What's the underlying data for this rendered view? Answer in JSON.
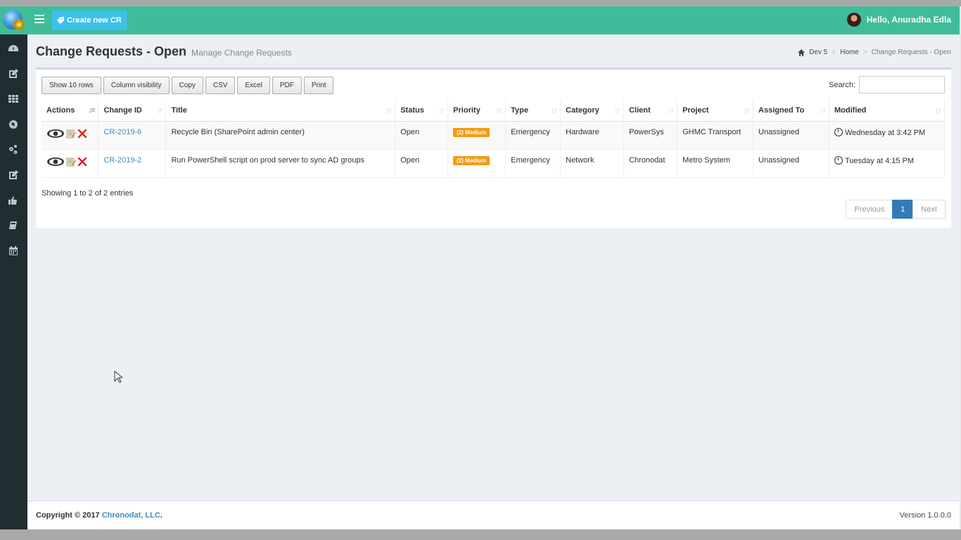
{
  "topbar": {
    "create_label": "Create new CR",
    "greeting": "Hello, Anuradha Edla"
  },
  "sidebar": {
    "icons": [
      "dashboard-icon",
      "edit-icon",
      "grid-icon",
      "globe-icon",
      "cogs-icon",
      "edit-icon",
      "thumbs-up-icon",
      "book-icon",
      "calendar-icon"
    ]
  },
  "page": {
    "title": "Change Requests - Open",
    "subtitle": "Manage Change Requests"
  },
  "breadcrumb": {
    "items": [
      "Dev 5",
      "Home",
      "Change Requests - Open"
    ]
  },
  "toolbar": {
    "buttons": [
      "Show 10 rows",
      "Column visibility",
      "Copy",
      "CSV",
      "Excel",
      "PDF",
      "Print"
    ],
    "search_label": "Search:",
    "search_value": ""
  },
  "table": {
    "columns": [
      "Actions",
      "Change ID",
      "Title",
      "Status",
      "Priority",
      "Type",
      "Category",
      "Client",
      "Project",
      "Assigned To",
      "Modified"
    ],
    "rows": [
      {
        "id": "CR-2019-6",
        "title": "Recycle Bin (SharePoint admin center)",
        "status": "Open",
        "priority": "(2) Medium",
        "type": "Emergency",
        "category": "Hardware",
        "client": "PowerSys",
        "project": "GHMC Transport",
        "assigned": "Unassigned",
        "modified": "Wednesday at 3:42 PM"
      },
      {
        "id": "CR-2019-2",
        "title": "Run PowerShell script on prod server to sync AD groups",
        "status": "Open",
        "priority": "(2) Medium",
        "type": "Emergency",
        "category": "Network",
        "client": "Chronodat",
        "project": "Metro System",
        "assigned": "Unassigned",
        "modified": "Tuesday at 4:15 PM"
      }
    ]
  },
  "info": "Showing 1 to 2 of 2 entries",
  "pager": {
    "previous": "Previous",
    "current": "1",
    "next": "Next"
  },
  "footer": {
    "copyright": "Copyright © 2017 ",
    "company": "Chronodat, LLC",
    "period": ".",
    "version": "Version 1.0.0.0"
  },
  "colors": {
    "accent": "#3fbd9a",
    "button": "#3ec1e9",
    "sidebar": "#222d32",
    "badge": "#f39c12",
    "link": "#3c8dbc"
  }
}
